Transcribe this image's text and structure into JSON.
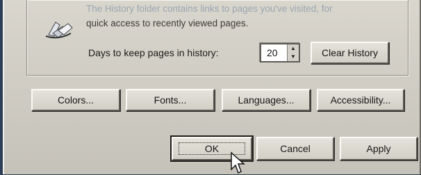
{
  "history": {
    "description_line1": "The History folder contains links to pages you've visited, for",
    "description_line2": "quick access to recently viewed pages.",
    "days_label": "Days to keep pages in history:",
    "days_value": "20",
    "clear_label": "Clear History"
  },
  "appearance_buttons": {
    "colors": "Colors...",
    "fonts": "Fonts...",
    "languages": "Languages...",
    "accessibility": "Accessibility..."
  },
  "dialog_buttons": {
    "ok": "OK",
    "cancel": "Cancel",
    "apply": "Apply"
  },
  "icons": {
    "history": "history-folder-icon",
    "spin_up": "up-arrow-icon",
    "spin_down": "down-arrow-icon",
    "cursor": "mouse-pointer-icon"
  }
}
